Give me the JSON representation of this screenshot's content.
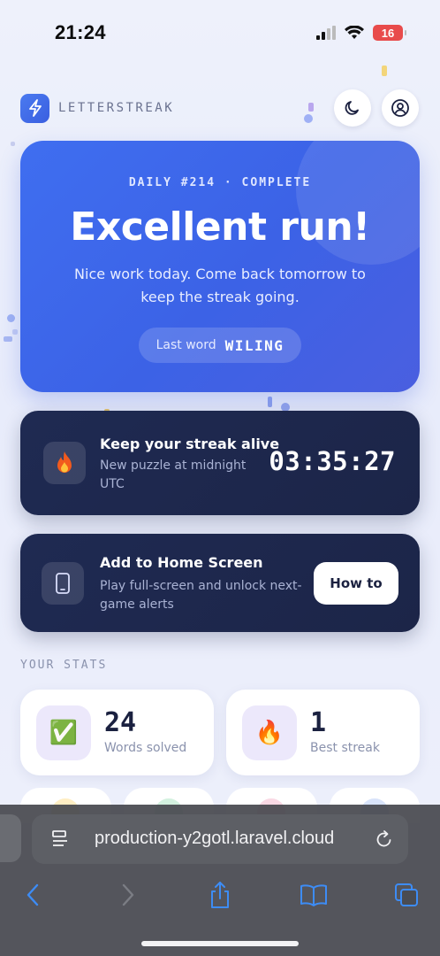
{
  "status_bar": {
    "time": "21:24",
    "battery": "16"
  },
  "brand": {
    "name": "LETTERSTREAK",
    "logo_icon": "lightning-icon"
  },
  "header_buttons": {
    "theme_icon": "moon-icon",
    "account_icon": "user-circle-icon"
  },
  "hero": {
    "eyebrow": "DAILY #214 · COMPLETE",
    "title": "Excellent run!",
    "subtitle": "Nice work today. Come back tomorrow to keep the streak going.",
    "last_word_label": "Last word",
    "last_word": "WILING"
  },
  "streak_card": {
    "icon": "fire-icon",
    "title": "Keep your streak alive",
    "text": "New puzzle at midnight UTC",
    "countdown": "03:35:27"
  },
  "home_card": {
    "icon": "phone-icon",
    "title": "Add to Home Screen",
    "text": "Play full-screen and unlock next-game alerts",
    "button_label": "How to"
  },
  "stats": {
    "section_label": "YOUR STATS",
    "items": [
      {
        "icon": "✅",
        "icon_name": "check-box-icon",
        "value": "24",
        "label": "Words solved"
      },
      {
        "icon": "🔥",
        "icon_name": "fire-icon",
        "value": "1",
        "label": "Best streak"
      }
    ]
  },
  "browser": {
    "url": "production-y2gotl.laravel.cloud",
    "toolbar_icons": [
      "back-icon",
      "forward-icon",
      "share-icon",
      "bookmarks-icon",
      "tabs-icon"
    ]
  },
  "colors": {
    "accent": "#3f6ef0",
    "dark_card": "#1f2a52",
    "battery_low": "#e84b4b"
  }
}
